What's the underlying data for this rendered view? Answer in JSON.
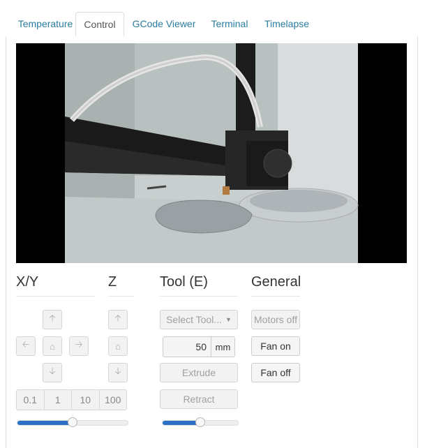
{
  "tabs": [
    {
      "label": "Temperature",
      "active": false
    },
    {
      "label": "Control",
      "active": true
    },
    {
      "label": "GCode Viewer",
      "active": false
    },
    {
      "label": "Terminal",
      "active": false
    },
    {
      "label": "Timelapse",
      "active": false
    }
  ],
  "sections": {
    "xy": "X/Y",
    "z": "Z",
    "tool": "Tool (E)",
    "general": "General"
  },
  "steps": [
    "0.1",
    "1",
    "10",
    "100"
  ],
  "tool": {
    "select_label": "Select Tool...",
    "amount": "50",
    "unit": "mm",
    "extrude": "Extrude",
    "retract": "Retract"
  },
  "general": {
    "motors_off": "Motors off",
    "fan_on": "Fan on",
    "fan_off": "Fan off"
  },
  "sliders": {
    "feedrate_level": 0.5,
    "flowrate_level": 0.5
  },
  "colors": {
    "tab_link": "#2a7ca0",
    "slider_fill": "#2b71c5"
  },
  "icons": {
    "up": "arrow-up-icon",
    "down": "arrow-down-icon",
    "left": "arrow-left-icon",
    "right": "arrow-right-icon",
    "home": "home-icon"
  }
}
